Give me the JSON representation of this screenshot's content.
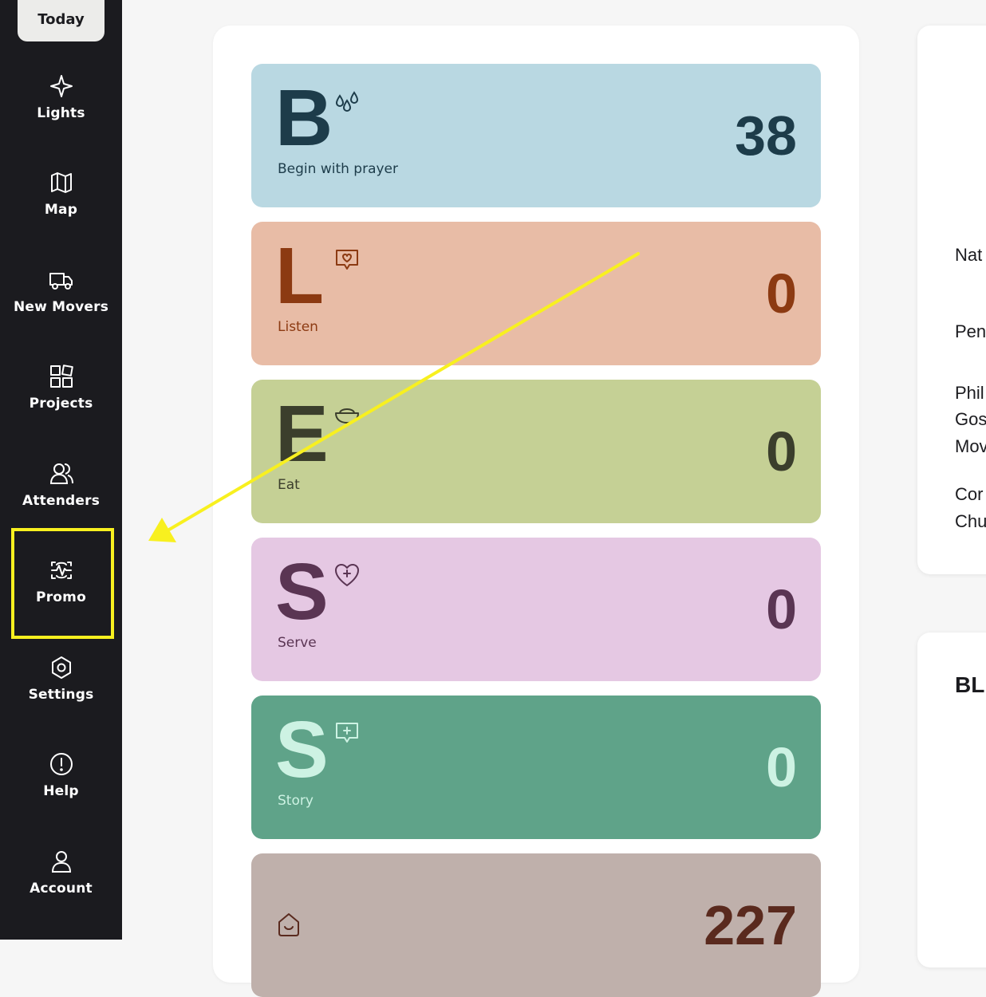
{
  "sidebar": {
    "today": "Today",
    "items": [
      {
        "label": "Lights",
        "icon": "sparkle-icon"
      },
      {
        "label": "Map",
        "icon": "map-icon"
      },
      {
        "label": "New Movers",
        "icon": "truck-icon"
      },
      {
        "label": "Projects",
        "icon": "grid-icon"
      },
      {
        "label": "Attenders",
        "icon": "users-icon"
      },
      {
        "label": "Promo",
        "icon": "promo-icon"
      },
      {
        "label": "Settings",
        "icon": "gear-icon"
      },
      {
        "label": "Help",
        "icon": "alert-circle-icon"
      },
      {
        "label": "Account",
        "icon": "user-icon"
      }
    ]
  },
  "cards": [
    {
      "letter": "B",
      "label": "Begin with prayer",
      "count": "38",
      "icon": "droplets-icon",
      "bg": "#b9d8e2",
      "fg": "#1d3c4a"
    },
    {
      "letter": "L",
      "label": "Listen",
      "count": "0",
      "icon": "heart-message-icon",
      "bg": "#e8bca6",
      "fg": "#8c3a12"
    },
    {
      "letter": "E",
      "label": "Eat",
      "count": "0",
      "icon": "bowl-icon",
      "bg": "#c5d095",
      "fg": "#3b3e2c"
    },
    {
      "letter": "S",
      "label": "Serve",
      "count": "0",
      "icon": "heart-plus-icon",
      "bg": "#e5c8e3",
      "fg": "#5a3553"
    },
    {
      "letter": "S",
      "label": "Story",
      "count": "0",
      "icon": "message-plus-icon",
      "bg": "#5fa389",
      "fg": "#cdf2e3"
    },
    {
      "letter": "",
      "label": "",
      "count": "227",
      "icon": "home-smile-icon",
      "bg": "#bfb0ab",
      "fg": "#5a2a1e"
    }
  ],
  "right_panel": {
    "lines": [
      "Nat",
      "Pen",
      "Phil",
      "Gos",
      "Mov",
      "Cor",
      "Chu"
    ],
    "heading": "BLI"
  },
  "annotation": {
    "highlight_color": "#f8f01f"
  }
}
